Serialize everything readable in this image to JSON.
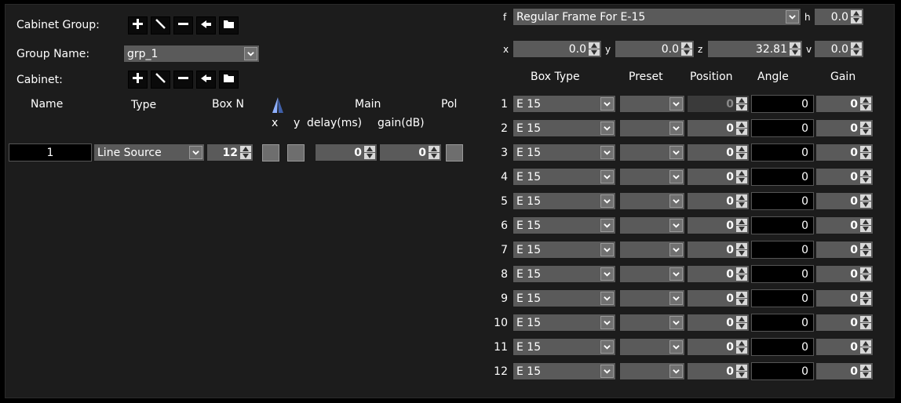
{
  "left_panel": {
    "cabinet_group_label": "Cabinet Group:",
    "group_name_label": "Group Name:",
    "group_name_value": "grp_1",
    "cabinet_label": "Cabinet:",
    "headers": {
      "name": "Name",
      "type": "Type",
      "box_n": "Box N",
      "main": "Main",
      "pol": "Pol",
      "x": "x",
      "y": "y",
      "delay": "delay(ms)",
      "gain": "gain(dB)"
    },
    "row": {
      "name": "1",
      "type": "Line Source",
      "box_n": "12",
      "delay": "0",
      "gain": "0"
    }
  },
  "right_panel": {
    "f_label": "f",
    "frame_value": "Regular Frame For E-15",
    "h_label": "h",
    "h_value": "0.0",
    "x_label": "x",
    "x_value": "0.0",
    "y_label": "y",
    "y_value": "0.0",
    "z_label": "z",
    "z_value": "32.81",
    "v_label": "v",
    "v_value": "0.0",
    "headers": {
      "box_type": "Box Type",
      "preset": "Preset",
      "position": "Position",
      "angle": "Angle",
      "gain": "Gain"
    },
    "rows": [
      {
        "num": "1",
        "box_type": "E 15",
        "position": "0",
        "angle": "0",
        "gain": "0"
      },
      {
        "num": "2",
        "box_type": "E 15",
        "position": "0",
        "angle": "0",
        "gain": "0"
      },
      {
        "num": "3",
        "box_type": "E 15",
        "position": "0",
        "angle": "0",
        "gain": "0"
      },
      {
        "num": "4",
        "box_type": "E 15",
        "position": "0",
        "angle": "0",
        "gain": "0"
      },
      {
        "num": "5",
        "box_type": "E 15",
        "position": "0",
        "angle": "0",
        "gain": "0"
      },
      {
        "num": "6",
        "box_type": "E 15",
        "position": "0",
        "angle": "0",
        "gain": "0"
      },
      {
        "num": "7",
        "box_type": "E 15",
        "position": "0",
        "angle": "0",
        "gain": "0"
      },
      {
        "num": "8",
        "box_type": "E 15",
        "position": "0",
        "angle": "0",
        "gain": "0"
      },
      {
        "num": "9",
        "box_type": "E 15",
        "position": "0",
        "angle": "0",
        "gain": "0"
      },
      {
        "num": "10",
        "box_type": "E 15",
        "position": "0",
        "angle": "0",
        "gain": "0"
      },
      {
        "num": "11",
        "box_type": "E 15",
        "position": "0",
        "angle": "0",
        "gain": "0"
      },
      {
        "num": "12",
        "box_type": "E 15",
        "position": "0",
        "angle": "0",
        "gain": "0"
      }
    ]
  },
  "icons": {
    "add": "plus-icon",
    "edit": "diagonal-line-icon",
    "remove": "minus-icon",
    "back": "arrow-back-icon",
    "folder": "folder-icon",
    "dropdown": "chevron-down-icon",
    "spin": "spin-arrows-icon",
    "polarity": "array-shape-icon"
  },
  "colors": {
    "background": "#1c1c1c",
    "field_bg": "#5a5a5a",
    "toolbar_icon": "#ffffff",
    "accent_blue": "#5a7fc8"
  }
}
